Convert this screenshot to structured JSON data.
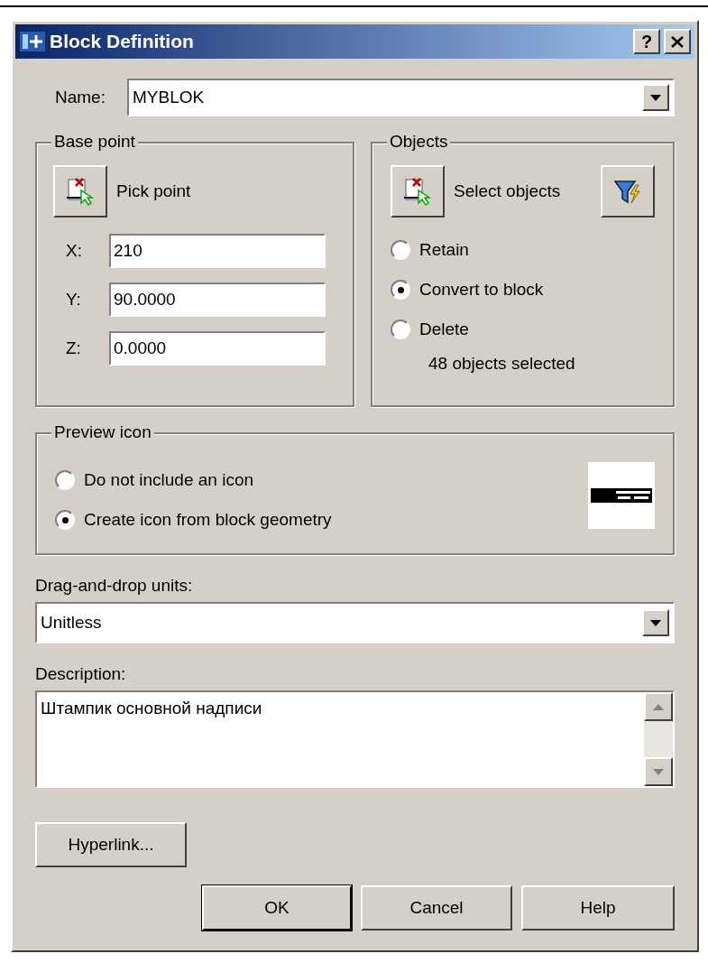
{
  "window": {
    "title": "Block Definition",
    "help_button": "?"
  },
  "name": {
    "label": "Name:",
    "value": "MYBLOK"
  },
  "base_point": {
    "title": "Base point",
    "pick_button": "Pick point",
    "coords": [
      {
        "label": "X:",
        "value": "210"
      },
      {
        "label": "Y:",
        "value": "90.0000"
      },
      {
        "label": "Z:",
        "value": "0.0000"
      }
    ]
  },
  "objects": {
    "title": "Objects",
    "select_button": "Select objects",
    "options": [
      {
        "label": "Retain",
        "selected": false
      },
      {
        "label": "Convert to block",
        "selected": true
      },
      {
        "label": "Delete",
        "selected": false
      }
    ],
    "status": "48 objects selected"
  },
  "preview_icon": {
    "title": "Preview icon",
    "options": [
      {
        "label": "Do not include an icon",
        "selected": false
      },
      {
        "label": "Create icon from block geometry",
        "selected": true
      }
    ]
  },
  "units": {
    "label": "Drag-and-drop units:",
    "value": "Unitless"
  },
  "description": {
    "label": "Description:",
    "value": "Штампик основной надписи"
  },
  "buttons": {
    "hyperlink": "Hyperlink...",
    "ok": "OK",
    "cancel": "Cancel",
    "help": "Help"
  }
}
